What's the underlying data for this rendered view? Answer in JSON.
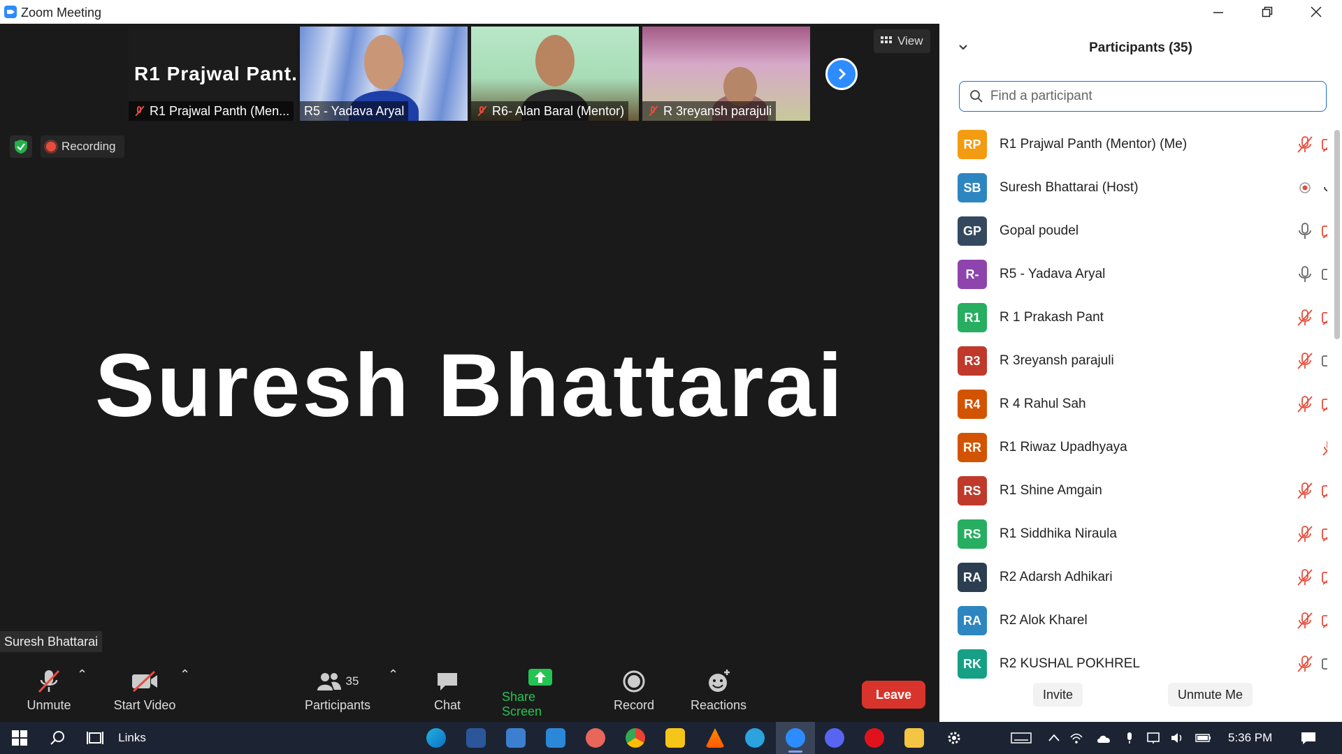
{
  "window": {
    "title": "Zoom Meeting"
  },
  "gallery": {
    "tiles": [
      {
        "big_name": "R1  Prajwal  Pant...",
        "label": "R1 Prajwal Panth (Men..."
      },
      {
        "label": "R5 - Yadava Aryal"
      },
      {
        "label": "R6- Alan Baral (Mentor)"
      },
      {
        "label": "R 3reyansh parajuli"
      }
    ]
  },
  "view_button": {
    "label": "View"
  },
  "recording": {
    "label": "Recording"
  },
  "active_speaker": {
    "name": "Suresh Bhattarai",
    "label": "Suresh Bhattarai"
  },
  "toolbar": {
    "unmute": "Unmute",
    "start_video": "Start Video",
    "participants": "Participants",
    "participants_count": "35",
    "chat": "Chat",
    "share_screen": "Share Screen",
    "record": "Record",
    "reactions": "Reactions",
    "leave": "Leave"
  },
  "panel": {
    "title": "Participants (35)",
    "search_placeholder": "Find a participant",
    "invite": "Invite",
    "unmute_me": "Unmute Me",
    "participants": [
      {
        "initials": "RP",
        "name": "R1 Prajwal Panth (Mentor) (Me)",
        "color": "#f39c12",
        "audio": "muted",
        "video": "off"
      },
      {
        "initials": "SB",
        "name": "Suresh Bhattarai (Host)",
        "color": "#2e86c1",
        "audio": "on",
        "video": "recording"
      },
      {
        "initials": "GP",
        "name": "Gopal poudel",
        "color": "#34495e",
        "audio": "on",
        "video": "off"
      },
      {
        "initials": "R-",
        "name": "R5 - Yadava Aryal",
        "color": "#8e44ad",
        "audio": "on",
        "video": "on"
      },
      {
        "initials": "R1",
        "name": "R 1 Prakash Pant",
        "color": "#27ae60",
        "audio": "muted",
        "video": "off"
      },
      {
        "initials": "R3",
        "name": "R 3reyansh parajuli",
        "color": "#c0392b",
        "audio": "muted",
        "video": "on"
      },
      {
        "initials": "R4",
        "name": "R 4 Rahul  Sah",
        "color": "#d35400",
        "audio": "muted",
        "video": "off"
      },
      {
        "initials": "RR",
        "name": "R1 Riwaz Upadhyaya",
        "color": "#d35400",
        "audio": "muted",
        "video": "none"
      },
      {
        "initials": "RS",
        "name": "R1 Shine Amgain",
        "color": "#c0392b",
        "audio": "muted",
        "video": "off"
      },
      {
        "initials": "RS",
        "name": "R1 Siddhika Niraula",
        "color": "#27ae60",
        "audio": "muted",
        "video": "off"
      },
      {
        "initials": "RA",
        "name": "R2 Adarsh Adhikari",
        "color": "#2c3e50",
        "audio": "muted",
        "video": "off"
      },
      {
        "initials": "RA",
        "name": "R2 Alok Kharel",
        "color": "#2e86c1",
        "audio": "muted",
        "video": "off"
      },
      {
        "initials": "RK",
        "name": "R2 KUSHAL POKHREL",
        "color": "#16a085",
        "audio": "muted",
        "video": "on"
      }
    ]
  },
  "taskbar": {
    "links_label": "Links",
    "clock": "5:36 PM"
  }
}
